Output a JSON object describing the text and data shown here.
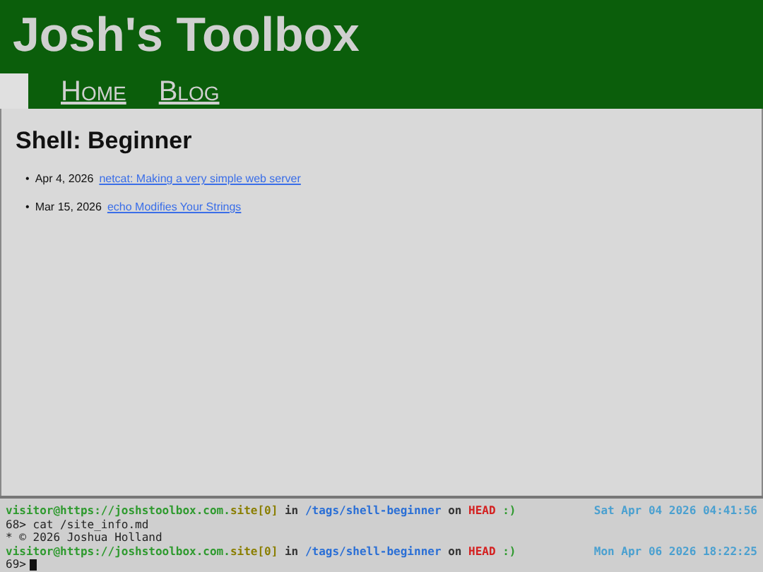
{
  "site_title": "Josh's Toolbox",
  "nav": [
    {
      "label": "Home"
    },
    {
      "label": "Blog"
    }
  ],
  "page_heading": "Shell: Beginner",
  "posts": [
    {
      "bullet": "•",
      "date": "Apr 4, 2026",
      "title": "netcat: Making a very simple web server"
    },
    {
      "bullet": "•",
      "date": "Mar 15, 2026",
      "title": "echo Modifies Your Strings"
    }
  ],
  "terminal": {
    "lines": [
      {
        "kind": "prompt",
        "segments": [
          {
            "text": "visitor@https://joshstoolbox.com.",
            "color": "#2e9a2e"
          },
          {
            "text": "site[0]",
            "color": "#8a7e00"
          },
          {
            "text": " in ",
            "color": "#333333"
          },
          {
            "text": "/tags/shell-beginner",
            "color": "#2a6fd6"
          },
          {
            "text": " on ",
            "color": "#333333"
          },
          {
            "text": "HEAD",
            "color": "#d42020"
          },
          {
            "text": " :)",
            "color": "#2e9a2e"
          }
        ],
        "time": "Sat Apr 04 2026 04:41:56"
      },
      {
        "kind": "output",
        "text": "68> cat /site_info.md"
      },
      {
        "kind": "output",
        "text": "* © 2026 Joshua Holland"
      },
      {
        "kind": "prompt",
        "segments": [
          {
            "text": "visitor@https://joshstoolbox.com.",
            "color": "#2e9a2e"
          },
          {
            "text": "site[0]",
            "color": "#8a7e00"
          },
          {
            "text": " in ",
            "color": "#333333"
          },
          {
            "text": "/tags/shell-beginner",
            "color": "#2a6fd6"
          },
          {
            "text": " on ",
            "color": "#333333"
          },
          {
            "text": "HEAD",
            "color": "#d42020"
          },
          {
            "text": " :)",
            "color": "#2e9a2e"
          }
        ],
        "time": "Mon Apr 06 2026 18:22:25"
      },
      {
        "kind": "input",
        "text": "69>"
      }
    ]
  }
}
